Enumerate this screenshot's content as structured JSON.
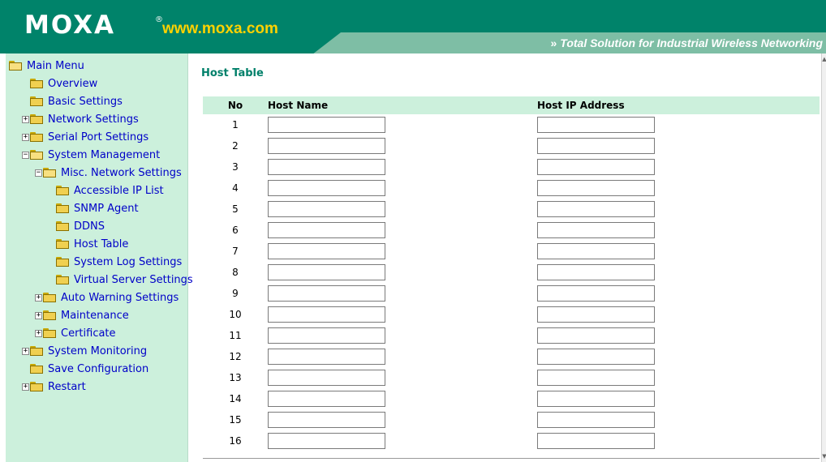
{
  "header": {
    "logo": "MOXA",
    "logo_mark": "®",
    "site_url": "www.moxa.com",
    "tagline": "Total Solution for Industrial Wireless Networking",
    "tagline_arrow": "»"
  },
  "colors": {
    "brand_green": "#00836a",
    "band_green": "#7ebea5",
    "sidebar_bg": "#ccf0dc",
    "link_blue": "#0000c8",
    "url_yellow": "#ffd200"
  },
  "sidebar": {
    "items": [
      {
        "label": "Main Menu",
        "expander": "",
        "folder": "open"
      },
      {
        "label": "Overview",
        "expander": "",
        "folder": "closed"
      },
      {
        "label": "Basic Settings",
        "expander": "",
        "folder": "closed"
      },
      {
        "label": "Network Settings",
        "expander": "+",
        "folder": "closed"
      },
      {
        "label": "Serial Port Settings",
        "expander": "+",
        "folder": "closed"
      },
      {
        "label": "System Management",
        "expander": "−",
        "folder": "open"
      },
      {
        "label": "Misc. Network Settings",
        "expander": "−",
        "folder": "open"
      },
      {
        "label": "Accessible IP List",
        "expander": "",
        "folder": "closed"
      },
      {
        "label": "SNMP Agent",
        "expander": "",
        "folder": "closed"
      },
      {
        "label": "DDNS",
        "expander": "",
        "folder": "closed"
      },
      {
        "label": "Host Table",
        "expander": "",
        "folder": "closed"
      },
      {
        "label": "System Log Settings",
        "expander": "",
        "folder": "closed"
      },
      {
        "label": "Virtual Server Settings",
        "expander": "",
        "folder": "closed"
      },
      {
        "label": "Auto Warning Settings",
        "expander": "+",
        "folder": "closed"
      },
      {
        "label": "Maintenance",
        "expander": "+",
        "folder": "closed"
      },
      {
        "label": "Certificate",
        "expander": "+",
        "folder": "closed"
      },
      {
        "label": "System Monitoring",
        "expander": "+",
        "folder": "closed"
      },
      {
        "label": "Save Configuration",
        "expander": "",
        "folder": "closed"
      },
      {
        "label": "Restart",
        "expander": "+",
        "folder": "closed"
      }
    ]
  },
  "main": {
    "title": "Host Table",
    "columns": {
      "no": "No",
      "host_name": "Host Name",
      "host_ip": "Host IP Address"
    },
    "rows": [
      {
        "no": "1",
        "host_name": "",
        "host_ip": ""
      },
      {
        "no": "2",
        "host_name": "",
        "host_ip": ""
      },
      {
        "no": "3",
        "host_name": "",
        "host_ip": ""
      },
      {
        "no": "4",
        "host_name": "",
        "host_ip": ""
      },
      {
        "no": "5",
        "host_name": "",
        "host_ip": ""
      },
      {
        "no": "6",
        "host_name": "",
        "host_ip": ""
      },
      {
        "no": "7",
        "host_name": "",
        "host_ip": ""
      },
      {
        "no": "8",
        "host_name": "",
        "host_ip": ""
      },
      {
        "no": "9",
        "host_name": "",
        "host_ip": ""
      },
      {
        "no": "10",
        "host_name": "",
        "host_ip": ""
      },
      {
        "no": "11",
        "host_name": "",
        "host_ip": ""
      },
      {
        "no": "12",
        "host_name": "",
        "host_ip": ""
      },
      {
        "no": "13",
        "host_name": "",
        "host_ip": ""
      },
      {
        "no": "14",
        "host_name": "",
        "host_ip": ""
      },
      {
        "no": "15",
        "host_name": "",
        "host_ip": ""
      },
      {
        "no": "16",
        "host_name": "",
        "host_ip": ""
      }
    ]
  }
}
